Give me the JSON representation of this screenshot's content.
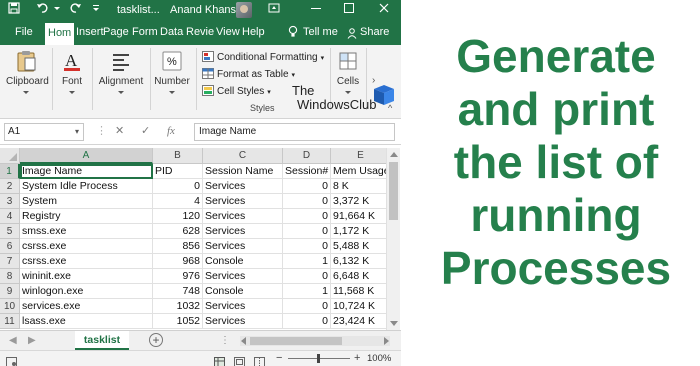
{
  "titlebar": {
    "filename": "tasklist...",
    "user": "Anand Khanse",
    "colors": {
      "excel_green": "#217346",
      "headline_green": "#25804c"
    },
    "icons": [
      "save-icon",
      "undo-icon",
      "dropdown-arrow-icon",
      "avatar",
      "ribbon-display-icon",
      "minimize-icon",
      "maximize-icon",
      "close-icon"
    ]
  },
  "tabs": [
    "File",
    "Hom",
    "Insert",
    "Page",
    "Form",
    "Data",
    "Revie",
    "View",
    "Help"
  ],
  "tell_me": "Tell me",
  "share": "Share",
  "ribbon": {
    "clipboard": "Clipboard",
    "font": "Font",
    "alignment": "Alignment",
    "number": "Number",
    "conditional_formatting": "Conditional Formatting",
    "format_as_table": "Format as Table",
    "cell_styles": "Cell Styles",
    "styles_group": "Styles",
    "cells": "Cells"
  },
  "watermark": {
    "line1": "The",
    "line2": "WindowsClub"
  },
  "formula_bar": {
    "name_box": "A1",
    "cancel": "✕",
    "enter": "✓",
    "fx": "fx",
    "content": "Image Name"
  },
  "sheet": {
    "columns": [
      "A",
      "B",
      "C",
      "D",
      "E"
    ],
    "rows": [
      "1",
      "2",
      "3",
      "4",
      "5",
      "6",
      "7",
      "8",
      "9",
      "10",
      "11"
    ],
    "cells": [
      [
        "Image Name",
        "PID",
        "Session Name",
        "Session#",
        "Mem Usage"
      ],
      [
        "System Idle Process",
        "0",
        "Services",
        "0",
        "8 K"
      ],
      [
        "System",
        "4",
        "Services",
        "0",
        "3,372 K"
      ],
      [
        "Registry",
        "120",
        "Services",
        "0",
        "91,664 K"
      ],
      [
        "smss.exe",
        "628",
        "Services",
        "0",
        "1,172 K"
      ],
      [
        "csrss.exe",
        "856",
        "Services",
        "0",
        "5,488 K"
      ],
      [
        "csrss.exe",
        "968",
        "Console",
        "1",
        "6,132 K"
      ],
      [
        "wininit.exe",
        "976",
        "Services",
        "0",
        "6,648 K"
      ],
      [
        "winlogon.exe",
        "748",
        "Console",
        "1",
        "11,568 K"
      ],
      [
        "services.exe",
        "1032",
        "Services",
        "0",
        "10,724 K"
      ],
      [
        "lsass.exe",
        "1052",
        "Services",
        "0",
        "23,424 K"
      ]
    ]
  },
  "sheet_tab": "tasklist",
  "add_sheet": "+",
  "zoom": {
    "minus": "−",
    "plus": "+",
    "percent": "100%"
  },
  "headline": [
    "Generate",
    "and print",
    "the list of",
    "running",
    "Processes"
  ]
}
